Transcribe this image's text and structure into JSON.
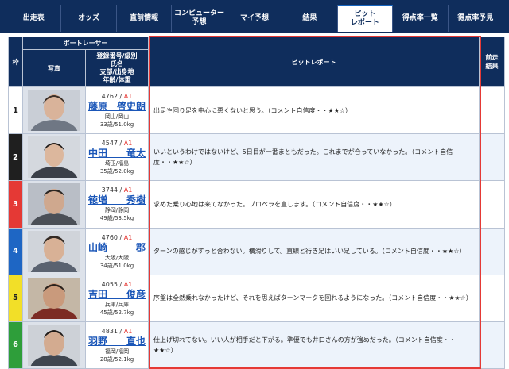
{
  "nav": {
    "tabs": [
      {
        "label": "出走表"
      },
      {
        "label": "オッズ"
      },
      {
        "label": "直前情報"
      },
      {
        "label": "コンピューター\n予想"
      },
      {
        "label": "マイ予想"
      },
      {
        "label": "結果"
      },
      {
        "label": "ピット\nレポート",
        "active": true
      },
      {
        "label": "得点率一覧"
      },
      {
        "label": "得点率予見"
      }
    ]
  },
  "table": {
    "headers": {
      "waku": "枠",
      "boat_racer": "ボートレーサー",
      "photo": "写真",
      "info_line1": "登録番号/級別",
      "info_line2": "氏名",
      "info_line3": "支部/出身地",
      "info_line4": "年齢/体重",
      "pit_report": "ピットレポート",
      "prev_result_1": "前走",
      "prev_result_2": "結果"
    },
    "rows": [
      {
        "waku": "1",
        "reg": "4762",
        "cls": "A1",
        "name": "藤原　啓史朗",
        "branch": "岡山/岡山",
        "age_weight": "33歳/51.0kg",
        "report": "出足や回り足を中心に悪くないと思う。（コメント自信度・・★★☆）"
      },
      {
        "waku": "2",
        "reg": "4547",
        "cls": "A1",
        "name": "中田　　竜太",
        "branch": "埼玉/福島",
        "age_weight": "35歳/52.0kg",
        "report": "いいというわけではないけど、5日目が一番まともだった。これまでが合っていなかった。（コメント自信度・・★★☆）"
      },
      {
        "waku": "3",
        "reg": "3744",
        "cls": "A1",
        "name": "徳増　　秀樹",
        "branch": "静岡/静岡",
        "age_weight": "49歳/53.5kg",
        "report": "求めた乗り心地は来てなかった。プロペラを直します。（コメント自信度・・★★☆）"
      },
      {
        "waku": "4",
        "reg": "4760",
        "cls": "A1",
        "name": "山崎　　　郡",
        "branch": "大阪/大阪",
        "age_weight": "34歳/51.0kg",
        "report": "ターンの感じがずっと合わない。横滑りして。直線と行き足はいい足している。（コメント自信度・・★★☆）"
      },
      {
        "waku": "5",
        "reg": "4055",
        "cls": "A1",
        "name": "吉田　　俊彦",
        "branch": "兵庫/兵庫",
        "age_weight": "45歳/52.7kg",
        "report": "序盤は全然乗れなかったけど、それを思えばターンマークを回れるようになった。（コメント自信度・・★★☆）"
      },
      {
        "waku": "6",
        "reg": "4831",
        "cls": "A1",
        "name": "羽野　　直也",
        "branch": "福岡/福岡",
        "age_weight": "28歳/52.1kg",
        "report": "仕上げ切れてない。いい人が相手だと下がる。準優でも井口さんの方が強めだった。（コメント自信度・・★★☆）"
      }
    ]
  },
  "colors": {
    "nav_bg": "#0f2d5c",
    "link": "#1a56b8",
    "class_red": "#e53935",
    "highlight": "#e53935"
  }
}
